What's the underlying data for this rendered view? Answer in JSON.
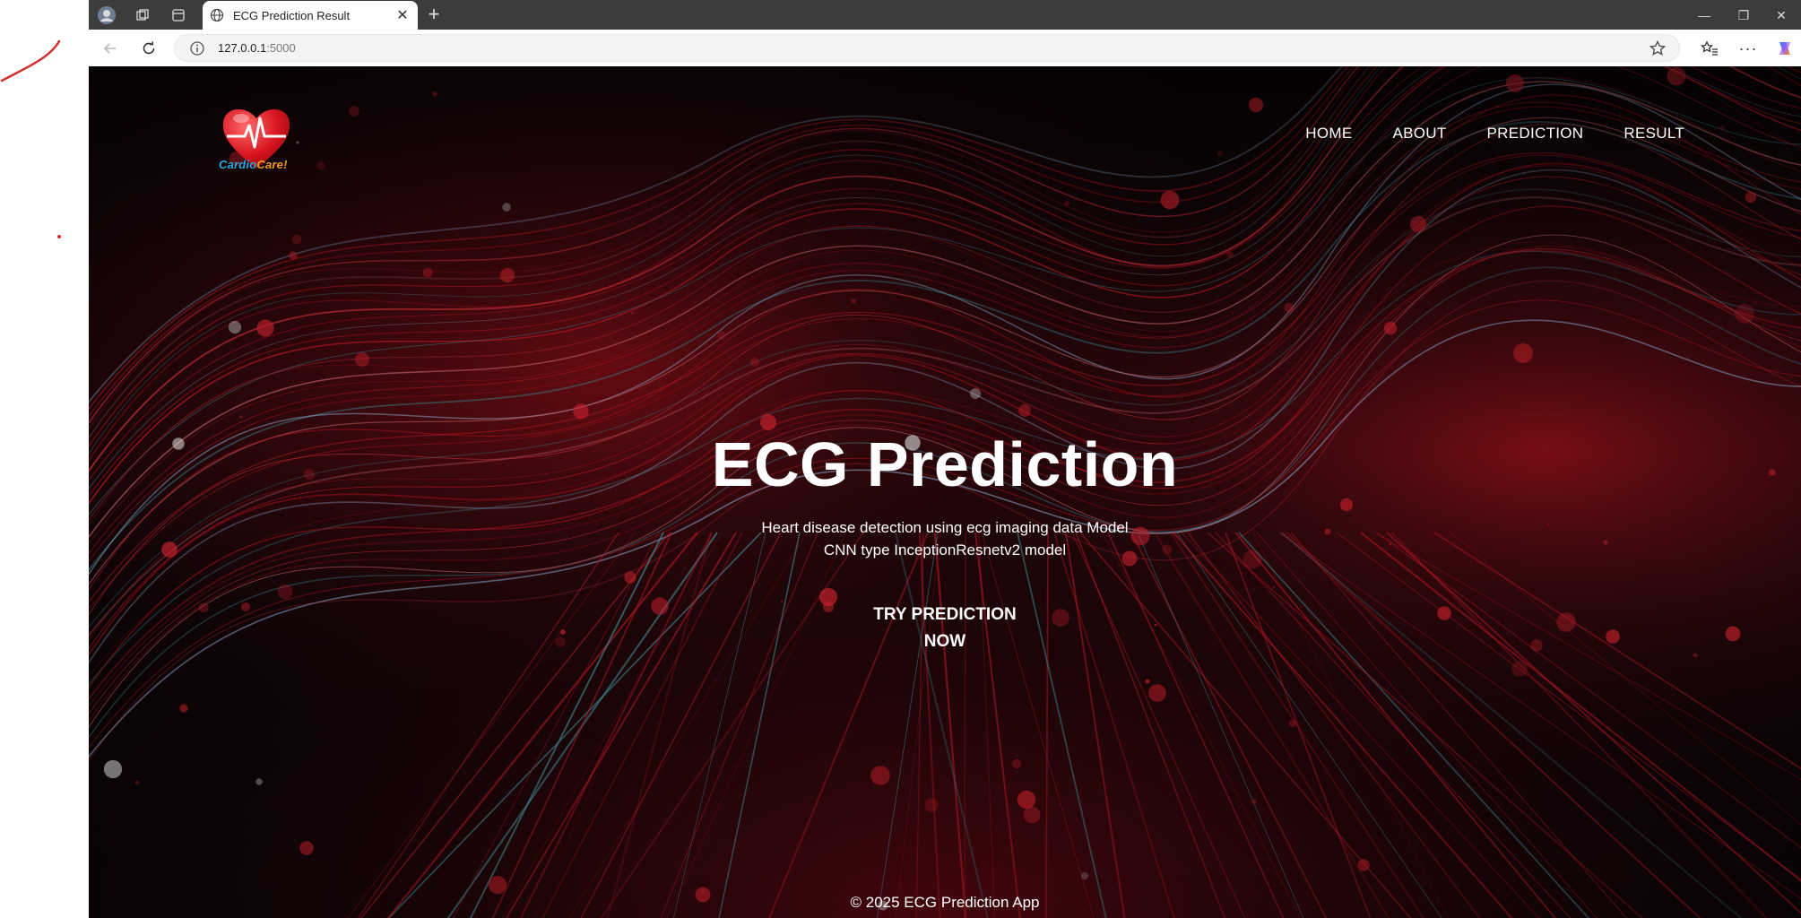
{
  "browser": {
    "tab_title": "ECG Prediction Result",
    "url_host": "127.0.0.1",
    "url_port": ":5000",
    "icons": [
      "profile-avatar-icon",
      "workspaces-icon",
      "tab-actions-icon",
      "globe-icon",
      "close-icon",
      "plus-icon",
      "minimize-icon",
      "restore-icon",
      "close-window-icon",
      "back-icon",
      "refresh-icon",
      "info-icon",
      "star-icon",
      "favorites-icon",
      "more-icon",
      "copilot-icon"
    ]
  },
  "site": {
    "logo_text_part1": "Cardio",
    "logo_text_part2": "Care!",
    "nav": [
      "HOME",
      "ABOUT",
      "PREDICTION",
      "RESULT"
    ],
    "hero": {
      "title": "ECG Prediction",
      "subtitle_line1": "Heart disease detection using ecg imaging data Model",
      "subtitle_line2": "CNN type InceptionResnetv2 model",
      "cta": "TRY PREDICTION NOW"
    },
    "footer": "© 2025 ECG Prediction App"
  },
  "colors": {
    "accent_red": "#c8102e",
    "page_bg": "#0b0406",
    "logo_blue": "#29a8e0",
    "logo_orange": "#f39a1f"
  }
}
